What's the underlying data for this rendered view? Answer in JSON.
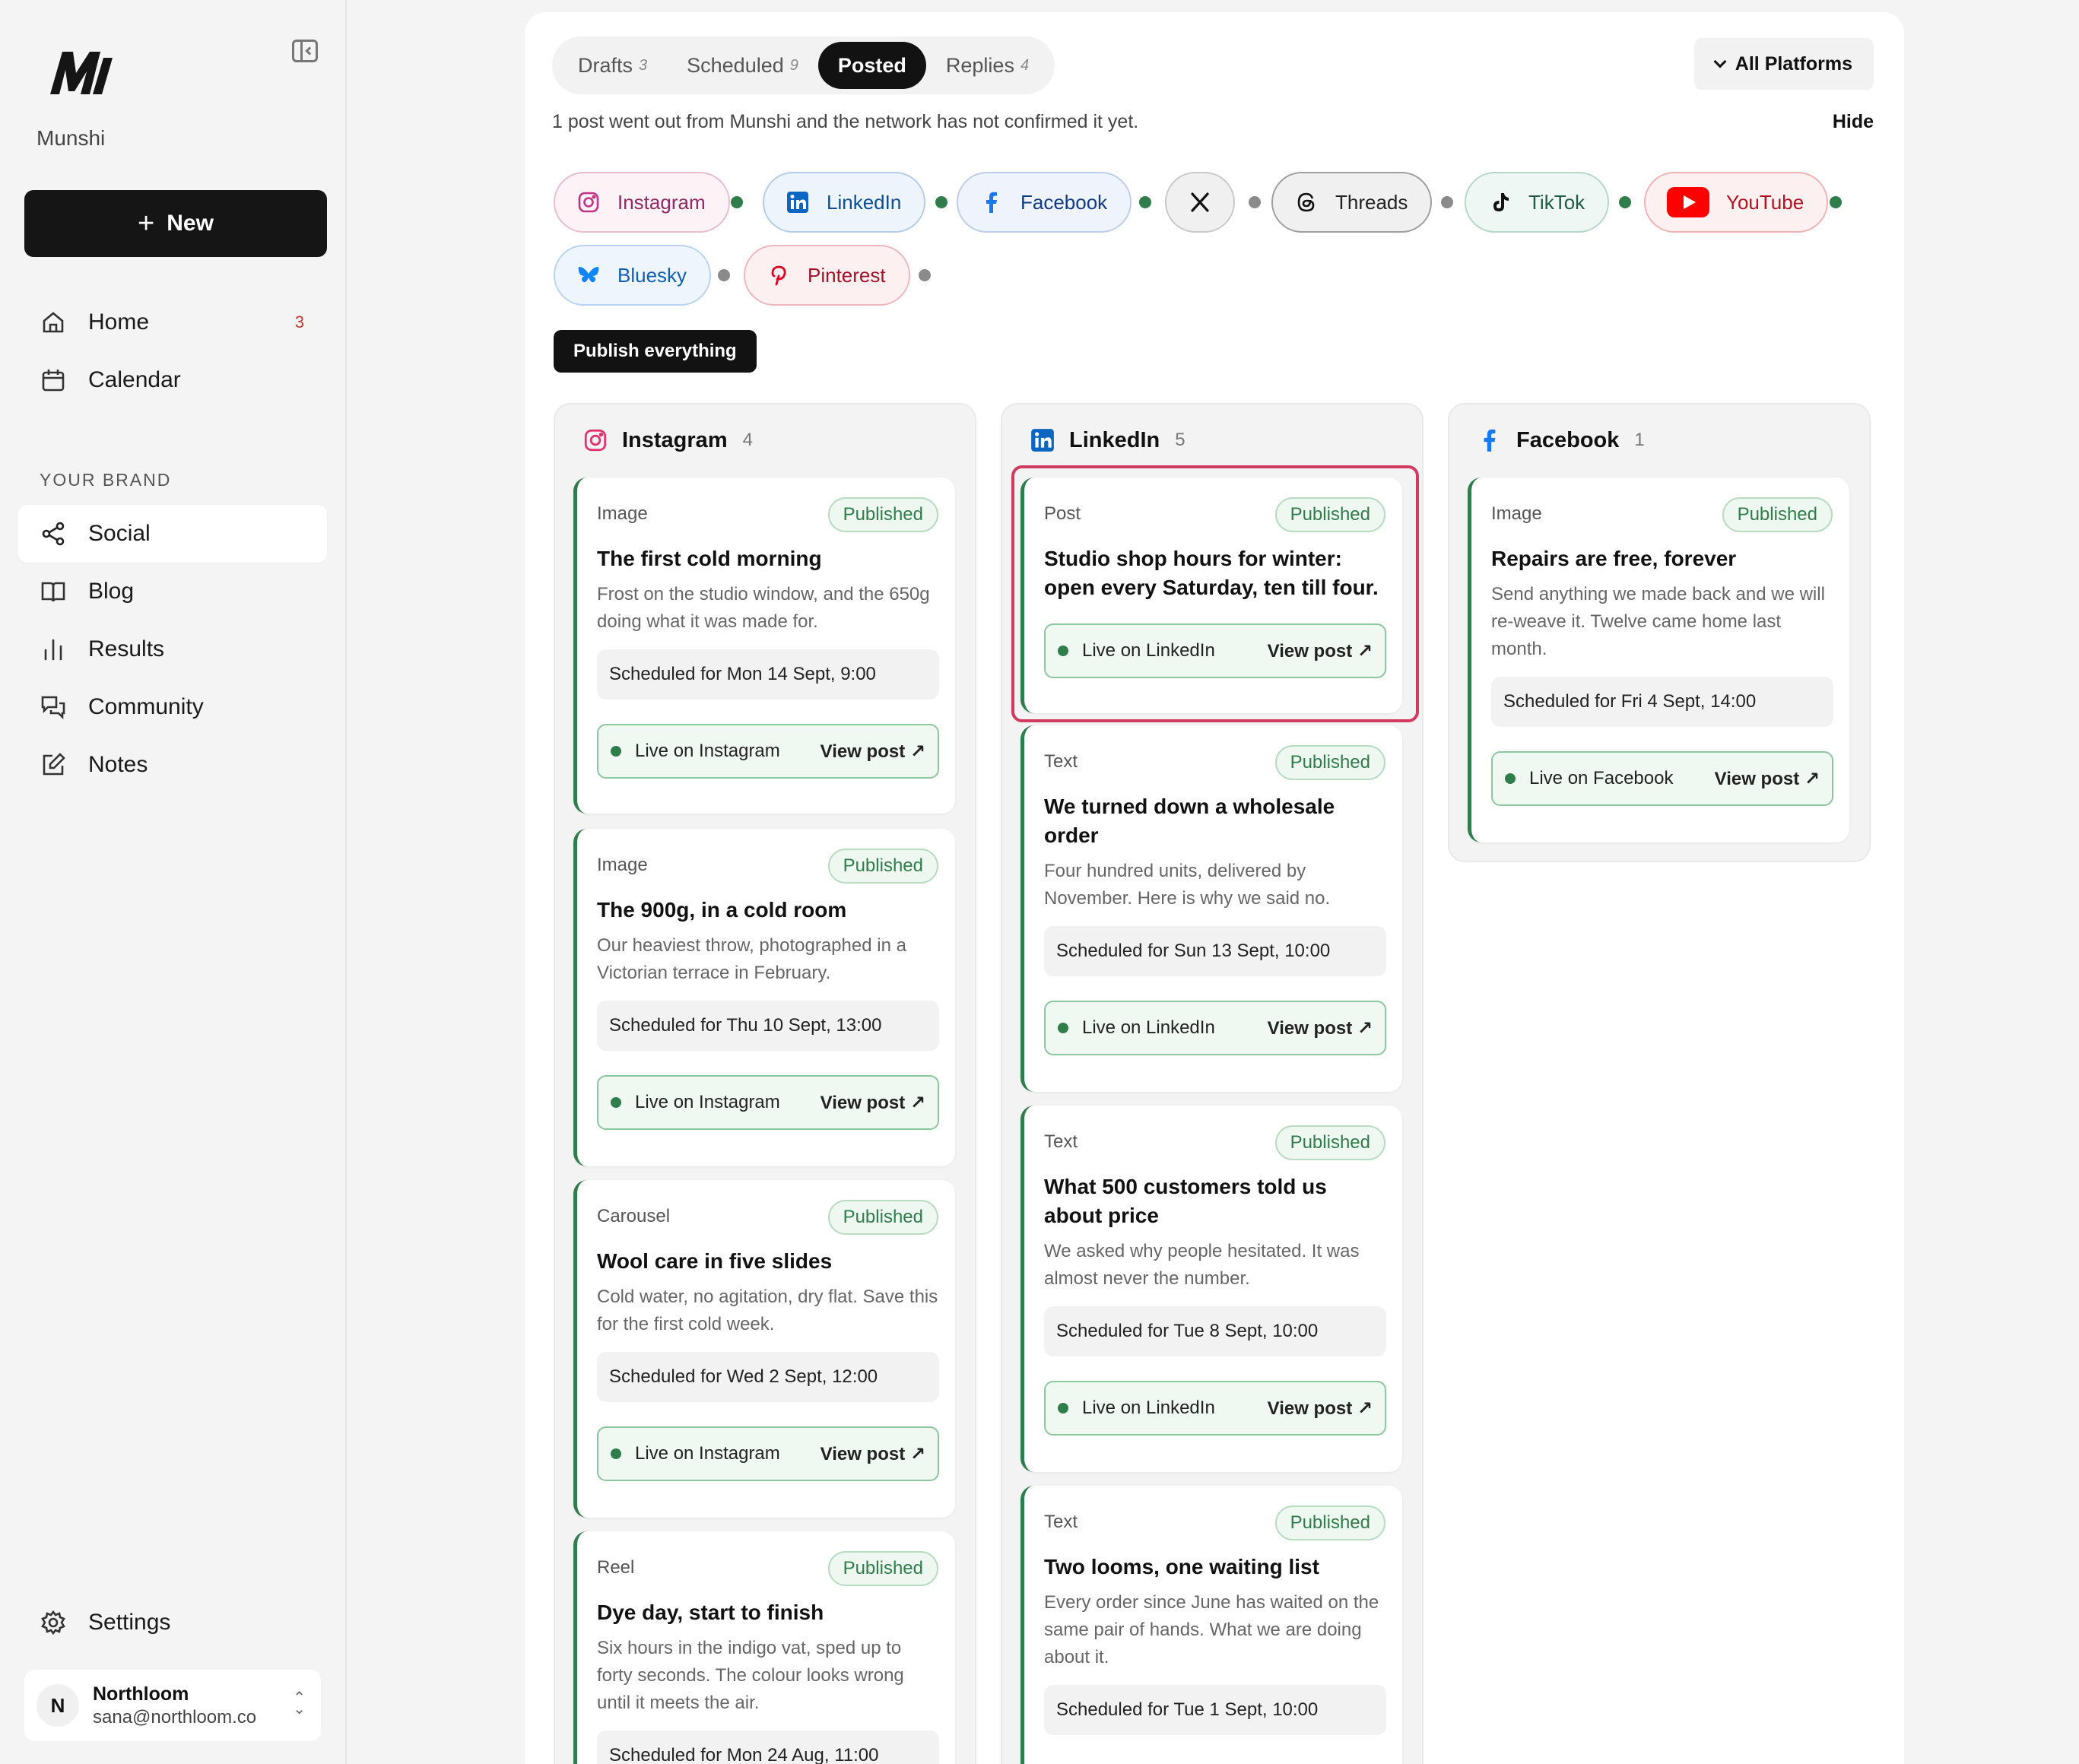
{
  "brand": {
    "name": "Munshi"
  },
  "sidebar": {
    "new_label": "New",
    "nav": [
      {
        "label": "Home",
        "count": "3"
      },
      {
        "label": "Calendar"
      }
    ],
    "section_label": "YOUR BRAND",
    "brand_nav": [
      {
        "label": "Social",
        "active": true
      },
      {
        "label": "Blog"
      },
      {
        "label": "Results"
      },
      {
        "label": "Community"
      },
      {
        "label": "Notes"
      }
    ],
    "settings_label": "Settings",
    "account": {
      "initial": "N",
      "name": "Northloom",
      "email": "sana@northloom.co"
    }
  },
  "tabs": [
    {
      "label": "Drafts",
      "count": "3"
    },
    {
      "label": "Scheduled",
      "count": "9"
    },
    {
      "label": "Posted",
      "active": true
    },
    {
      "label": "Replies",
      "count": "4"
    }
  ],
  "platform_filter": "All Platforms",
  "notice": "1 post went out from Munshi and the network has not confirmed it yet.",
  "hide_label": "Hide",
  "platform_chips": [
    {
      "label": "Instagram",
      "icon": "instagram-icon",
      "color": "#c13584",
      "status": "green"
    },
    {
      "label": "LinkedIn",
      "icon": "linkedin-icon",
      "color": "#0a66c2",
      "status": "green"
    },
    {
      "label": "Facebook",
      "icon": "facebook-icon",
      "color": "#1877f2",
      "status": "green"
    },
    {
      "label": "",
      "icon": "x-icon",
      "color": "#111111",
      "status": "grey"
    },
    {
      "label": "Threads",
      "icon": "threads-icon",
      "color": "#111111",
      "status": "grey"
    },
    {
      "label": "TikTok",
      "icon": "tiktok-icon",
      "color": "#111111",
      "status": "green"
    },
    {
      "label": "YouTube",
      "icon": "youtube-icon",
      "color": "#ff0000",
      "status": "green"
    },
    {
      "label": "Bluesky",
      "icon": "bluesky-icon",
      "color": "#1185fe",
      "status": "grey"
    },
    {
      "label": "Pinterest",
      "icon": "pinterest-icon",
      "color": "#e60023",
      "status": "grey"
    }
  ],
  "publish_label": "Publish everything",
  "columns": [
    {
      "name": "Instagram",
      "count": "4",
      "cards": [
        {
          "kind": "Image",
          "status": "Published",
          "title": "The first cold morning",
          "body": "Frost on the studio window, and the 650g doing what it was made for.",
          "schedule": "Scheduled for Mon 14 Sept, 9:00",
          "live": "Live on Instagram",
          "view": "View post ↗"
        },
        {
          "kind": "Image",
          "status": "Published",
          "title": "The 900g, in a cold room",
          "body": "Our heaviest throw, photographed in a Victorian terrace in February.",
          "schedule": "Scheduled for Thu 10 Sept, 13:00",
          "live": "Live on Instagram",
          "view": "View post ↗"
        },
        {
          "kind": "Carousel",
          "status": "Published",
          "title": "Wool care in five slides",
          "body": "Cold water, no agitation, dry flat. Save this for the first cold week.",
          "schedule": "Scheduled for Wed 2 Sept, 12:00",
          "live": "Live on Instagram",
          "view": "View post ↗"
        },
        {
          "kind": "Reel",
          "status": "Published",
          "title": "Dye day, start to finish",
          "body": "Six hours in the indigo vat, sped up to forty seconds. The colour looks wrong until it meets the air.",
          "schedule": "Scheduled for Mon 24 Aug, 11:00"
        }
      ]
    },
    {
      "name": "LinkedIn",
      "count": "5",
      "cards": [
        {
          "kind": "Post",
          "status": "Published",
          "title": "Studio shop hours for winter: open every Saturday, ten till four.",
          "live": "Live on LinkedIn",
          "view": "View post ↗"
        },
        {
          "kind": "Text",
          "status": "Published",
          "title": "We turned down a wholesale order",
          "body": "Four hundred units, delivered by November. Here is why we said no.",
          "schedule": "Scheduled for Sun 13 Sept, 10:00",
          "live": "Live on LinkedIn",
          "view": "View post ↗"
        },
        {
          "kind": "Text",
          "status": "Published",
          "title": "What 500 customers told us about price",
          "body": "We asked why people hesitated. It was almost never the number.",
          "schedule": "Scheduled for Tue 8 Sept, 10:00",
          "live": "Live on LinkedIn",
          "view": "View post ↗"
        },
        {
          "kind": "Text",
          "status": "Published",
          "title": "Two looms, one waiting list",
          "body": "Every order since June has waited on the same pair of hands. What we are doing about it.",
          "schedule": "Scheduled for Tue 1 Sept, 10:00"
        }
      ]
    },
    {
      "name": "Facebook",
      "count": "1",
      "cards": [
        {
          "kind": "Image",
          "status": "Published",
          "title": "Repairs are free, forever",
          "body": "Send anything we made back and we will re-weave it. Twelve came home last month.",
          "schedule": "Scheduled for Fri 4 Sept, 14:00",
          "live": "Live on Facebook",
          "view": "View post ↗"
        }
      ]
    }
  ]
}
